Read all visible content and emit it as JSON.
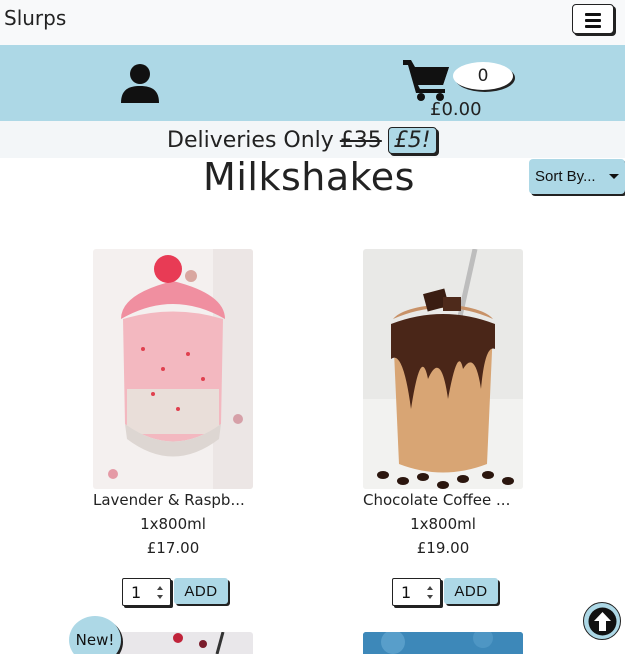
{
  "header": {
    "brand": "Slurps",
    "menu_icon": "hamburger-icon"
  },
  "account": {
    "icon": "user-icon"
  },
  "cart": {
    "icon": "cart-icon",
    "count": "0",
    "total": "£0.00"
  },
  "promo": {
    "text": "Deliveries Only",
    "old_price": "£35",
    "new_price": "£5!"
  },
  "page": {
    "title": "Milkshakes",
    "sort_label": "Sort By..."
  },
  "products": [
    {
      "name": "Lavender & Raspb...",
      "size": "1x800ml",
      "price": "£17.00",
      "qty": "1",
      "add_label": "ADD"
    },
    {
      "name": "Chocolate Coffee ...",
      "size": "1x800ml",
      "price": "£19.00",
      "qty": "1",
      "add_label": "ADD"
    }
  ],
  "next_row": {
    "badge": "New!"
  },
  "scroll_top": {
    "icon": "arrow-up-circle-icon"
  },
  "colors": {
    "accent": "#add8e6",
    "topbar": "#f8f9fa",
    "text": "#222222"
  }
}
